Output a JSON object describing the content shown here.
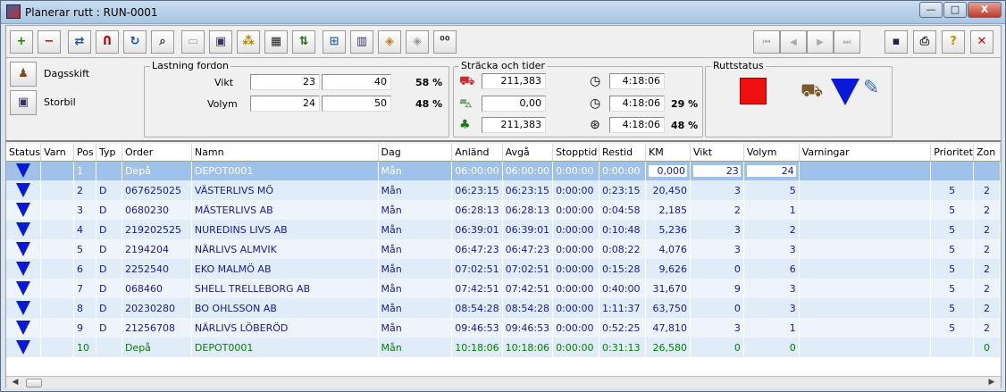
{
  "window": {
    "title": "Planerar rutt : RUN-0001",
    "min_label": "—",
    "max_label": "□",
    "close_label": "X"
  },
  "toolbar": {
    "buttons": [
      {
        "name": "add-icon",
        "glyph": "+",
        "color": "#0a8a0a"
      },
      {
        "name": "remove-icon",
        "glyph": "−",
        "color": "#cc0000"
      },
      {
        "name": "insert-stop-icon",
        "glyph": "⇄",
        "color": "#1a4fb0"
      },
      {
        "name": "magnet-icon",
        "glyph": "Ո",
        "color": "#b00000"
      },
      {
        "name": "refresh-icon",
        "glyph": "↻",
        "color": "#1a4fb0"
      },
      {
        "name": "zoom-icon",
        "glyph": "⌕",
        "color": "#333333"
      },
      {
        "name": "blank-doc-icon",
        "glyph": "▭",
        "color": "#aaaaaa"
      },
      {
        "name": "truck-front-icon",
        "glyph": "▣",
        "color": "#333366"
      },
      {
        "name": "ants-icon",
        "glyph": "⁂",
        "color": "#b08000"
      },
      {
        "name": "calculator-icon",
        "glyph": "▦",
        "color": "#222222"
      },
      {
        "name": "sort-icon",
        "glyph": "⇅",
        "color": "#1a6a1a"
      },
      {
        "name": "map-icon",
        "glyph": "⊞",
        "color": "#2a6ab0"
      },
      {
        "name": "film-icon",
        "glyph": "▥",
        "color": "#333366"
      },
      {
        "name": "box-icon",
        "glyph": "◈",
        "color": "#c08020"
      },
      {
        "name": "box-grey-icon",
        "glyph": "◈",
        "color": "#999999"
      },
      {
        "name": "numbering-icon",
        "glyph": "⁰⁰",
        "color": "#333333"
      }
    ],
    "nav": [
      {
        "name": "first-record-icon",
        "glyph": "⏮"
      },
      {
        "name": "prev-record-icon",
        "glyph": "◀"
      },
      {
        "name": "next-record-icon",
        "glyph": "▶"
      },
      {
        "name": "last-record-icon",
        "glyph": "⏭"
      }
    ],
    "right": [
      {
        "name": "save-icon",
        "glyph": "▪",
        "color": "#222244"
      },
      {
        "name": "print-icon",
        "glyph": "⎙",
        "color": "#333333"
      },
      {
        "name": "help-icon",
        "glyph": "?",
        "color": "#c89000"
      },
      {
        "name": "close-icon",
        "glyph": "✕",
        "color": "#cc0000"
      }
    ]
  },
  "side": {
    "shift_label": "Dagsskift",
    "vehicle_label": "Storbil"
  },
  "load": {
    "title": "Lastning fordon",
    "weight_label": "Vikt",
    "weight_value": "23",
    "weight_max": "40",
    "weight_pct": "58 %",
    "volume_label": "Volym",
    "volume_value": "24",
    "volume_max": "50",
    "volume_pct": "48 %"
  },
  "distance": {
    "title": "Sträcka och tider",
    "d1": "211,383",
    "d2": "0,00",
    "d3": "211,383",
    "t1": "4:18:06",
    "t2": "4:18:06",
    "t3": "4:18:06",
    "pct2": "29 %",
    "pct3": "48 %"
  },
  "status": {
    "title": "Ruttstatus"
  },
  "grid": {
    "columns": [
      "Status",
      "Varn",
      "Pos",
      "Typ",
      "Order",
      "Namn",
      "Dag",
      "Anländ",
      "Avgå",
      "Stopptid",
      "Restid",
      "KM",
      "Vikt",
      "Volym",
      "Varningar",
      "Prioritet",
      "Zon"
    ],
    "rows": [
      {
        "pos": "1",
        "typ": "",
        "order": "Depå",
        "namn": "DEPOT0001",
        "dag": "Mån",
        "anland": "06:00:00",
        "avga": "06:00:00",
        "stopp": "0:00:00",
        "restid": "0:00:00",
        "km": "0,000",
        "vikt": "23",
        "volym": "24",
        "varn": "",
        "prio": "",
        "zon": "",
        "style": "r-sel"
      },
      {
        "pos": "2",
        "typ": "D",
        "order": "067625025",
        "namn": "VÄSTERLIVS MÖ",
        "dag": "Mån",
        "anland": "06:23:15",
        "avga": "06:23:15",
        "stopp": "0:00:00",
        "restid": "0:23:15",
        "km": "20,450",
        "vikt": "3",
        "volym": "5",
        "varn": "",
        "prio": "5",
        "zon": "2",
        "style": "r-a"
      },
      {
        "pos": "3",
        "typ": "D",
        "order": "0680230",
        "namn": "MÄSTERLIVS AB",
        "dag": "Mån",
        "anland": "06:28:13",
        "avga": "06:28:13",
        "stopp": "0:00:00",
        "restid": "0:04:58",
        "km": "2,185",
        "vikt": "2",
        "volym": "1",
        "varn": "",
        "prio": "5",
        "zon": "2",
        "style": "r-b"
      },
      {
        "pos": "4",
        "typ": "D",
        "order": "219202525",
        "namn": "NUREDINS LIVS AB",
        "dag": "Mån",
        "anland": "06:39:01",
        "avga": "06:39:01",
        "stopp": "0:00:00",
        "restid": "0:10:48",
        "km": "5,236",
        "vikt": "3",
        "volym": "2",
        "varn": "",
        "prio": "5",
        "zon": "2",
        "style": "r-a"
      },
      {
        "pos": "5",
        "typ": "D",
        "order": "2194204",
        "namn": "NÄRLIVS ALMVIK",
        "dag": "Mån",
        "anland": "06:47:23",
        "avga": "06:47:23",
        "stopp": "0:00:00",
        "restid": "0:08:22",
        "km": "4,076",
        "vikt": "3",
        "volym": "3",
        "varn": "",
        "prio": "5",
        "zon": "2",
        "style": "r-b"
      },
      {
        "pos": "6",
        "typ": "D",
        "order": "2252540",
        "namn": "EKO MALMÖ AB",
        "dag": "Mån",
        "anland": "07:02:51",
        "avga": "07:02:51",
        "stopp": "0:00:00",
        "restid": "0:15:28",
        "km": "9,626",
        "vikt": "0",
        "volym": "6",
        "varn": "",
        "prio": "5",
        "zon": "2",
        "style": "r-a"
      },
      {
        "pos": "7",
        "typ": "D",
        "order": "068460",
        "namn": "SHELL TRELLEBORG AB",
        "dag": "Mån",
        "anland": "07:42:51",
        "avga": "07:42:51",
        "stopp": "0:00:00",
        "restid": "0:40:00",
        "km": "31,670",
        "vikt": "9",
        "volym": "3",
        "varn": "",
        "prio": "5",
        "zon": "2",
        "style": "r-b"
      },
      {
        "pos": "8",
        "typ": "D",
        "order": "20230280",
        "namn": "BO OHLSSON AB",
        "dag": "Mån",
        "anland": "08:54:28",
        "avga": "08:54:28",
        "stopp": "0:00:00",
        "restid": "1:11:37",
        "km": "63,750",
        "vikt": "0",
        "volym": "3",
        "varn": "",
        "prio": "5",
        "zon": "2",
        "style": "r-a"
      },
      {
        "pos": "9",
        "typ": "D",
        "order": "21256708",
        "namn": "NÄRLIVS LÖBERÖD",
        "dag": "Mån",
        "anland": "09:46:53",
        "avga": "09:46:53",
        "stopp": "0:00:00",
        "restid": "0:52:25",
        "km": "47,810",
        "vikt": "3",
        "volym": "1",
        "varn": "",
        "prio": "5",
        "zon": "2",
        "style": "r-b"
      },
      {
        "pos": "10",
        "typ": "",
        "order": "Depå",
        "namn": "DEPOT0001",
        "dag": "Mån",
        "anland": "10:18:06",
        "avga": "10:18:06",
        "stopp": "0:00:00",
        "restid": "0:31:13",
        "km": "26,580",
        "vikt": "0",
        "volym": "0",
        "varn": "",
        "prio": "",
        "zon": "0",
        "style": "r-end"
      }
    ]
  },
  "colors": {
    "accent": "#0a18d8",
    "selected_row": "#9fc1ea",
    "status_red": "#ee1010"
  }
}
